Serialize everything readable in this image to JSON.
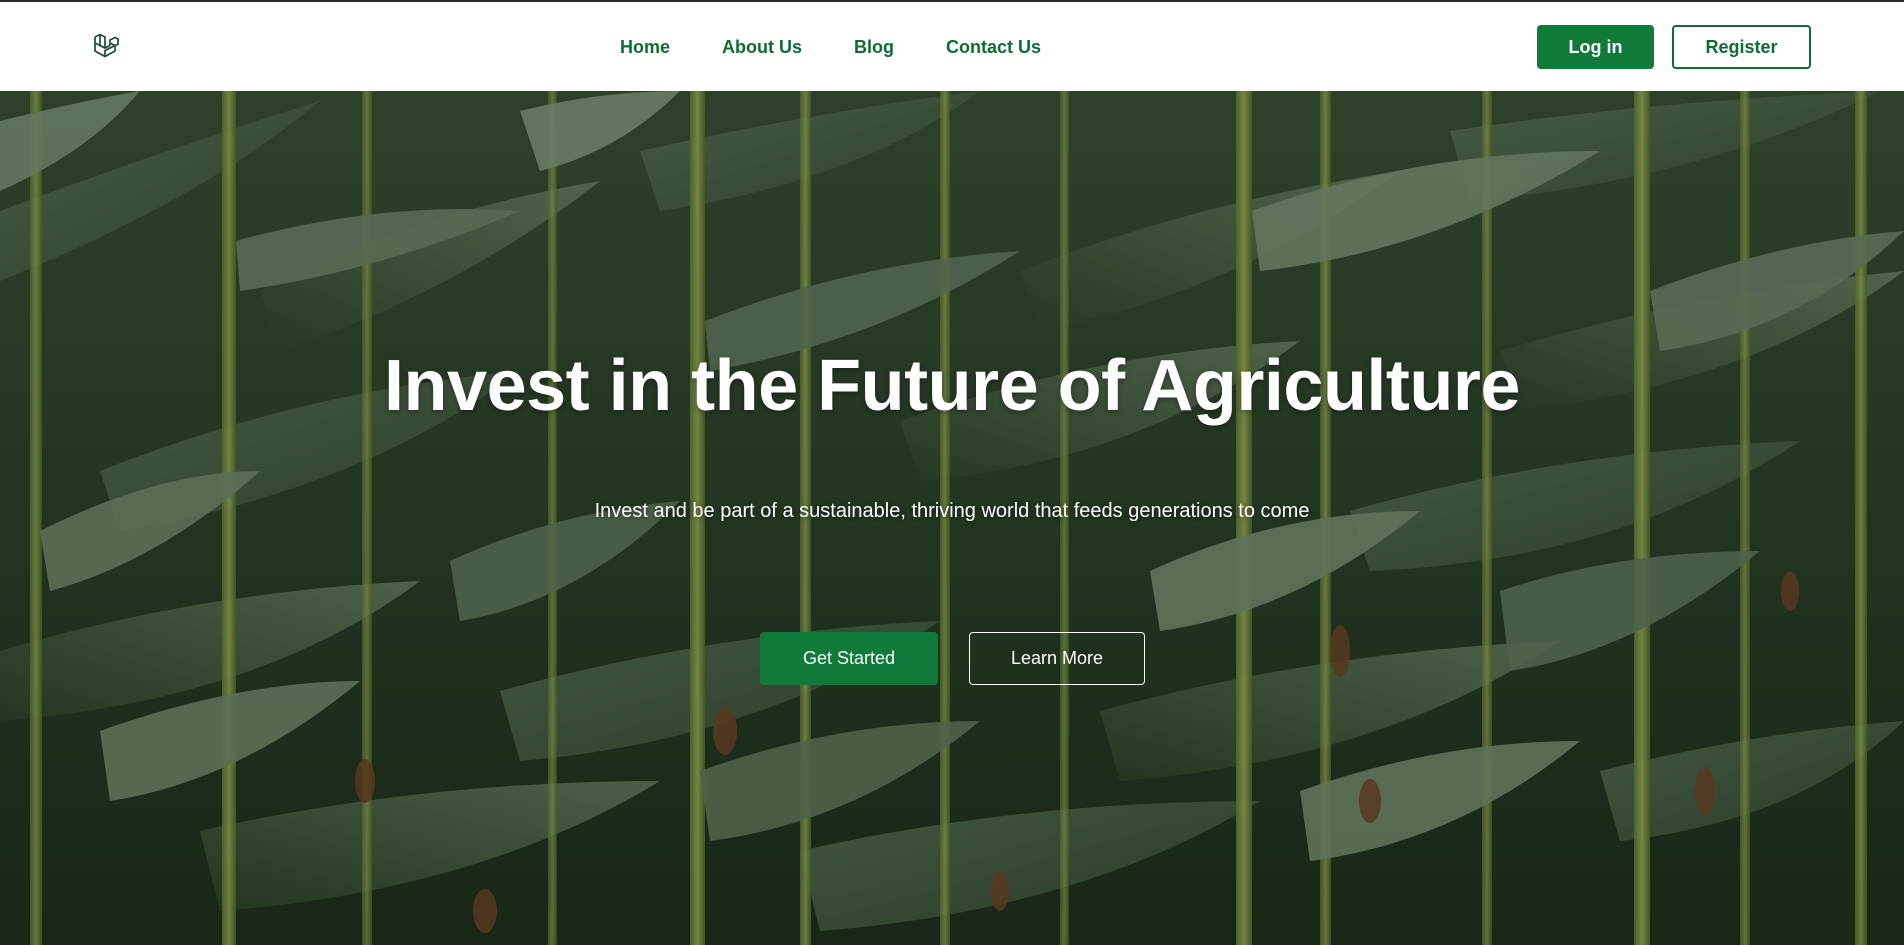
{
  "brand": {
    "logo_icon": "laravel-logo-icon",
    "accent": "#0f7a3a",
    "text_green": "#0f6b35"
  },
  "nav": {
    "links": [
      {
        "label": "Home"
      },
      {
        "label": "About Us"
      },
      {
        "label": "Blog"
      },
      {
        "label": "Contact Us"
      }
    ],
    "login_label": "Log in",
    "register_label": "Register"
  },
  "hero": {
    "title": "Invest in the Future of Agriculture",
    "subtitle": "Invest and be part of a sustainable, thriving world that feeds generations to come",
    "primary_cta": "Get Started",
    "secondary_cta": "Learn More",
    "background": "corn-field-image"
  }
}
